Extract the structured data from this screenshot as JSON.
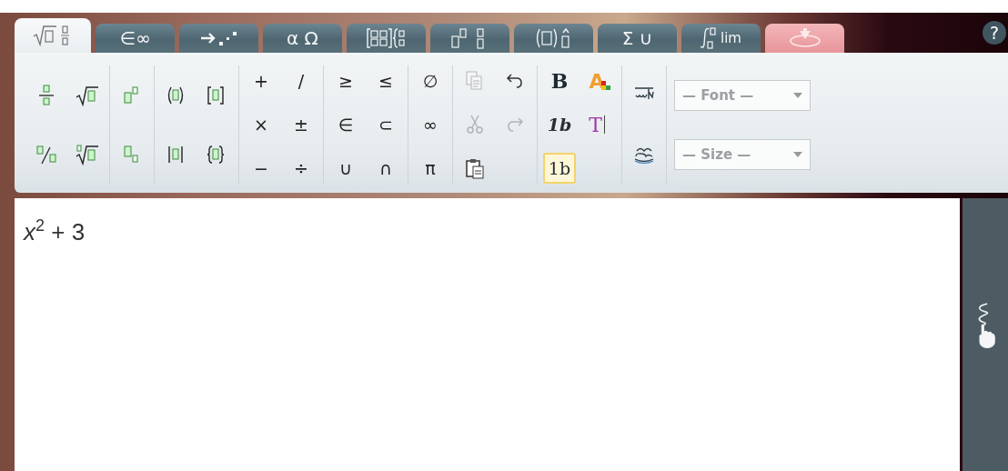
{
  "tabs": [
    {
      "kind": "radical-fraction",
      "selected": true
    },
    {
      "kind": "text",
      "label": "∈∞",
      "selected": false
    },
    {
      "kind": "arrow-dots",
      "selected": false
    },
    {
      "kind": "text",
      "label": "α Ω",
      "selected": false
    },
    {
      "kind": "matrix",
      "selected": false
    },
    {
      "kind": "scripts",
      "selected": false
    },
    {
      "kind": "bracket-accent",
      "selected": false
    },
    {
      "kind": "text",
      "label": "Σ ∪",
      "selected": false
    },
    {
      "kind": "integral",
      "label": "lim",
      "selected": false
    },
    {
      "kind": "download",
      "selected": false
    }
  ],
  "help": {
    "label": "?"
  },
  "toolbar": {
    "groups": [
      {
        "rows": [
          [
            {
              "kind": "fraction"
            },
            {
              "kind": "sqrt"
            }
          ],
          [
            {
              "kind": "slashfraction"
            },
            {
              "kind": "nthroot"
            }
          ]
        ]
      },
      {
        "rows": [
          [
            {
              "kind": "superscript"
            }
          ],
          [
            {
              "kind": "subscript"
            }
          ]
        ]
      },
      {
        "rows": [
          [
            {
              "kind": "parens"
            },
            {
              "kind": "brackets"
            }
          ],
          [
            {
              "kind": "abs"
            },
            {
              "kind": "braces"
            }
          ]
        ]
      },
      {
        "rows": [
          [
            {
              "kind": "symbol",
              "label": "+"
            },
            {
              "kind": "symbol",
              "label": "/"
            }
          ],
          [
            {
              "kind": "symbol",
              "label": "×"
            },
            {
              "kind": "symbol",
              "label": "±"
            }
          ],
          [
            {
              "kind": "symbol",
              "label": "−"
            },
            {
              "kind": "symbol",
              "label": "÷"
            }
          ]
        ]
      },
      {
        "rows": [
          [
            {
              "kind": "symbol",
              "label": "≥"
            },
            {
              "kind": "symbol",
              "label": "≤"
            }
          ],
          [
            {
              "kind": "symbol",
              "label": "∈"
            },
            {
              "kind": "symbol",
              "label": "⊂"
            }
          ],
          [
            {
              "kind": "symbol",
              "label": "∪"
            },
            {
              "kind": "symbol",
              "label": "∩"
            }
          ]
        ]
      },
      {
        "rows": [
          [
            {
              "kind": "symbol",
              "label": "∅"
            }
          ],
          [
            {
              "kind": "symbol",
              "label": "∞"
            }
          ],
          [
            {
              "kind": "symbol",
              "label": "π"
            }
          ]
        ]
      },
      {
        "rows": [
          [
            {
              "kind": "copy",
              "disabled": true
            },
            {
              "kind": "undo",
              "disabled": false
            }
          ],
          [
            {
              "kind": "cut",
              "disabled": true
            },
            {
              "kind": "redo",
              "disabled": true
            }
          ],
          [
            {
              "kind": "paste",
              "disabled": false
            }
          ]
        ]
      },
      {
        "rows": [
          [
            {
              "kind": "bold",
              "label": "B",
              "selected": false
            },
            {
              "kind": "color",
              "label": "A",
              "selected": false
            }
          ],
          [
            {
              "kind": "italic",
              "label": "1b",
              "selected": false
            },
            {
              "kind": "text",
              "label": "T",
              "selected": false
            }
          ],
          [
            {
              "kind": "normal",
              "label": "1b",
              "selected": true
            }
          ]
        ]
      },
      {
        "rows": [
          [
            {
              "kind": "scriptltr"
            }
          ],
          [
            {
              "kind": "scriptrtl"
            }
          ]
        ]
      }
    ],
    "selects": [
      {
        "placeholder": "— Font —",
        "disabled": true
      },
      {
        "placeholder": "— Size —",
        "disabled": true
      }
    ]
  },
  "editor": {
    "content": "*x*$^{2}$ + 3"
  }
}
